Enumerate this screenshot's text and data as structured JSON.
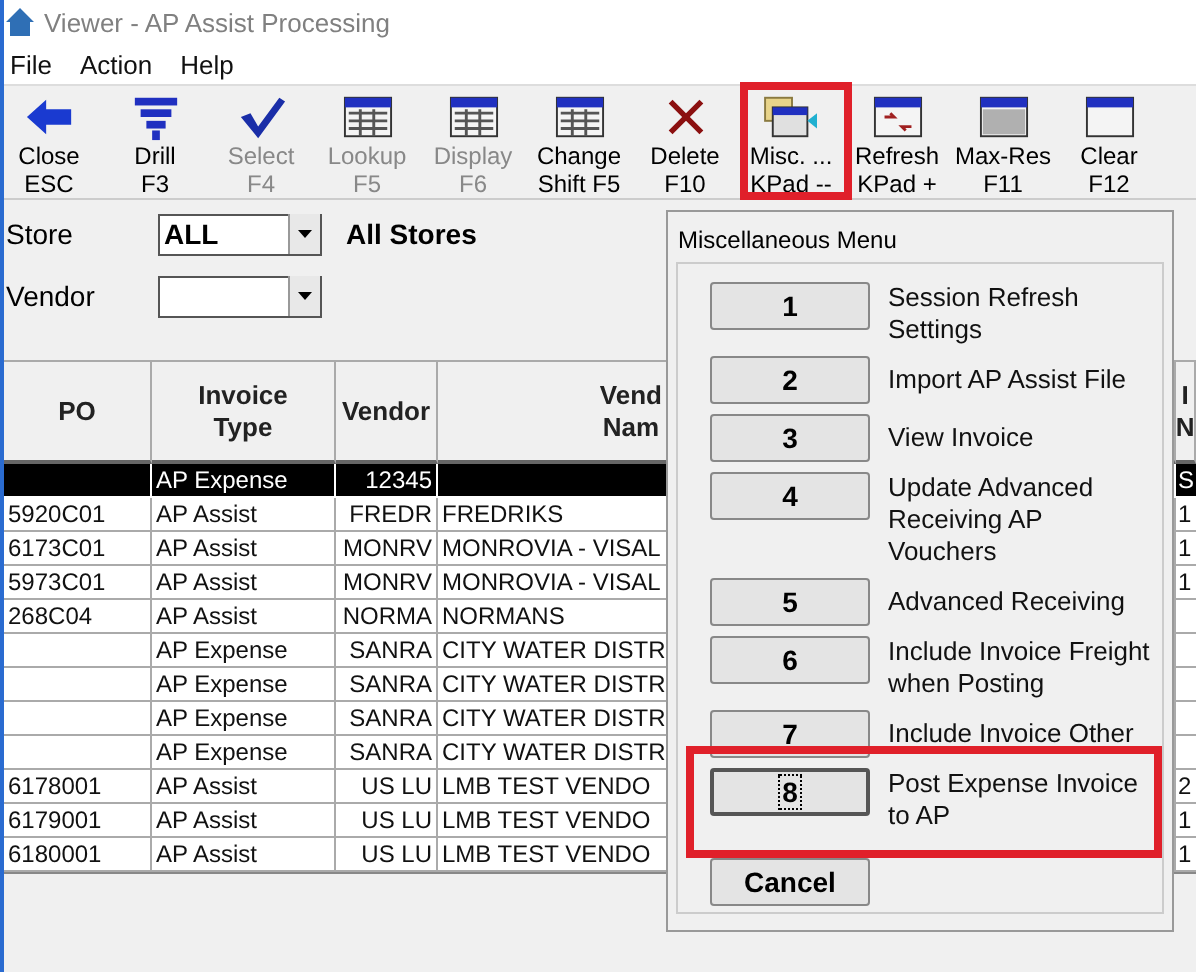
{
  "window": {
    "title": "Viewer - AP Assist Processing"
  },
  "menu": [
    "File",
    "Action",
    "Help"
  ],
  "toolbar": [
    {
      "label": "Close",
      "key": "ESC",
      "disabled": false,
      "highlighted": false
    },
    {
      "label": "Drill",
      "key": "F3",
      "disabled": false,
      "highlighted": false
    },
    {
      "label": "Select",
      "key": "F4",
      "disabled": true,
      "highlighted": false
    },
    {
      "label": "Lookup",
      "key": "F5",
      "disabled": true,
      "highlighted": false
    },
    {
      "label": "Display",
      "key": "F6",
      "disabled": true,
      "highlighted": false
    },
    {
      "label": "Change",
      "key": "Shift F5",
      "disabled": false,
      "highlighted": false
    },
    {
      "label": "Delete",
      "key": "F10",
      "disabled": false,
      "highlighted": false
    },
    {
      "label": "Misc. ...",
      "key": "KPad --",
      "disabled": false,
      "highlighted": true
    },
    {
      "label": "Refresh",
      "key": "KPad +",
      "disabled": false,
      "highlighted": false
    },
    {
      "label": "Max-Res",
      "key": "F11",
      "disabled": false,
      "highlighted": false
    },
    {
      "label": "Clear",
      "key": "F12",
      "disabled": false,
      "highlighted": false
    }
  ],
  "filters": {
    "store": {
      "label": "Store",
      "value": "ALL",
      "description": "All Stores"
    },
    "vendor": {
      "label": "Vendor"
    }
  },
  "table": {
    "columns": [
      {
        "lines": [
          "PO"
        ]
      },
      {
        "lines": [
          "Invoice",
          "Type"
        ]
      },
      {
        "lines": [
          "Vendor"
        ]
      },
      {
        "lines": [
          "Vend",
          "Nam"
        ]
      },
      {
        "lines": [
          "I",
          "N"
        ]
      }
    ],
    "rows": [
      {
        "cells": [
          null,
          "AP Expense",
          "12345",
          null,
          "S"
        ],
        "selected": true
      },
      {
        "cells": [
          "5920C01",
          "AP Assist",
          "FREDR",
          "FREDRIKS",
          "1"
        ],
        "selected": false
      },
      {
        "cells": [
          "6173C01",
          "AP Assist",
          "MONRV",
          "MONROVIA - VISAL",
          "1"
        ],
        "selected": false
      },
      {
        "cells": [
          "5973C01",
          "AP Assist",
          "MONRV",
          "MONROVIA - VISAL",
          "1"
        ],
        "selected": false
      },
      {
        "cells": [
          "268C04",
          "AP Assist",
          "NORMA",
          "NORMANS",
          null
        ],
        "selected": false
      },
      {
        "cells": [
          null,
          "AP Expense",
          "SANRA",
          "CITY WATER DISTR",
          null
        ],
        "selected": false
      },
      {
        "cells": [
          null,
          "AP Expense",
          "SANRA",
          "CITY WATER DISTR",
          null
        ],
        "selected": false
      },
      {
        "cells": [
          null,
          "AP Expense",
          "SANRA",
          "CITY WATER DISTR",
          null
        ],
        "selected": false
      },
      {
        "cells": [
          null,
          "AP Expense",
          "SANRA",
          "CITY WATER DISTR",
          null
        ],
        "selected": false
      },
      {
        "cells": [
          "6178001",
          "AP Assist",
          "US LU",
          "LMB TEST VENDO",
          "2"
        ],
        "selected": false
      },
      {
        "cells": [
          "6179001",
          "AP Assist",
          "US LU",
          "LMB TEST VENDO",
          "1"
        ],
        "selected": false
      },
      {
        "cells": [
          "6180001",
          "AP Assist",
          "US LU",
          "LMB TEST VENDO",
          "1"
        ],
        "selected": false
      }
    ]
  },
  "dialog": {
    "title": "Miscellaneous Menu",
    "items": [
      {
        "key": "1",
        "lines": [
          "Session Refresh",
          "Settings"
        ],
        "selected": false,
        "highlighted": false
      },
      {
        "key": "2",
        "lines": [
          "Import AP Assist File"
        ],
        "selected": false,
        "highlighted": false
      },
      {
        "key": "3",
        "lines": [
          "View Invoice"
        ],
        "selected": false,
        "highlighted": false
      },
      {
        "key": "4",
        "lines": [
          "Update Advanced",
          "Receiving AP",
          "Vouchers"
        ],
        "selected": false,
        "highlighted": false
      },
      {
        "key": "5",
        "lines": [
          "Advanced Receiving"
        ],
        "selected": false,
        "highlighted": false
      },
      {
        "key": "6",
        "lines": [
          "Include Invoice Freight",
          "when Posting"
        ],
        "selected": false,
        "highlighted": false
      },
      {
        "key": "7",
        "lines": [
          "Include Invoice Other"
        ],
        "selected": false,
        "highlighted": false
      },
      {
        "key": "8",
        "lines": [
          "Post Expense Invoice",
          "to AP"
        ],
        "selected": true,
        "highlighted": true
      }
    ],
    "cancel": "Cancel"
  }
}
